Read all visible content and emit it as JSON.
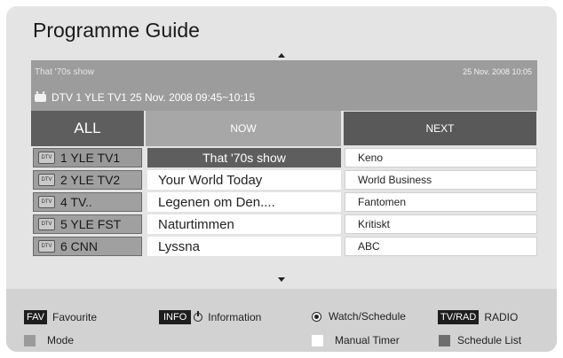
{
  "title": "Programme Guide",
  "info": {
    "show": "That '70s show",
    "datetime": "25 Nov. 2008 10:05",
    "channel_line": "DTV  1 YLE TV1 25 Nov. 2008 09:45~10:15"
  },
  "columns": {
    "all": "ALL",
    "now": "NOW",
    "next": "NEXT"
  },
  "rows": [
    {
      "channel": "1  YLE TV1",
      "now": "That '70s show",
      "next": "Keno"
    },
    {
      "channel": "2  YLE TV2",
      "now": "Your World Today",
      "next": "World Business"
    },
    {
      "channel": "4  TV..",
      "now": "Legenen om Den....",
      "next": "Fantomen"
    },
    {
      "channel": "5  YLE FST",
      "now": "Naturtimmen",
      "next": "Kritiskt"
    },
    {
      "channel": "6  CNN",
      "now": "Lyssna",
      "next": "ABC"
    }
  ],
  "dtv_badge": "DTV",
  "footer": {
    "fav_key": "FAV",
    "fav_label": "Favourite",
    "info_key": "INFO",
    "info_label": "Information",
    "watch_label": "Watch/Schedule",
    "tvrad_key": "TV/RAD",
    "tvrad_label": "RADIO",
    "mode_label": "Mode",
    "manual_label": "Manual Timer",
    "schedule_label": "Schedule List"
  },
  "colors": {
    "selected": "#5e5e5e",
    "header_next": "#595959",
    "info_bar": "#9c9c9c"
  }
}
